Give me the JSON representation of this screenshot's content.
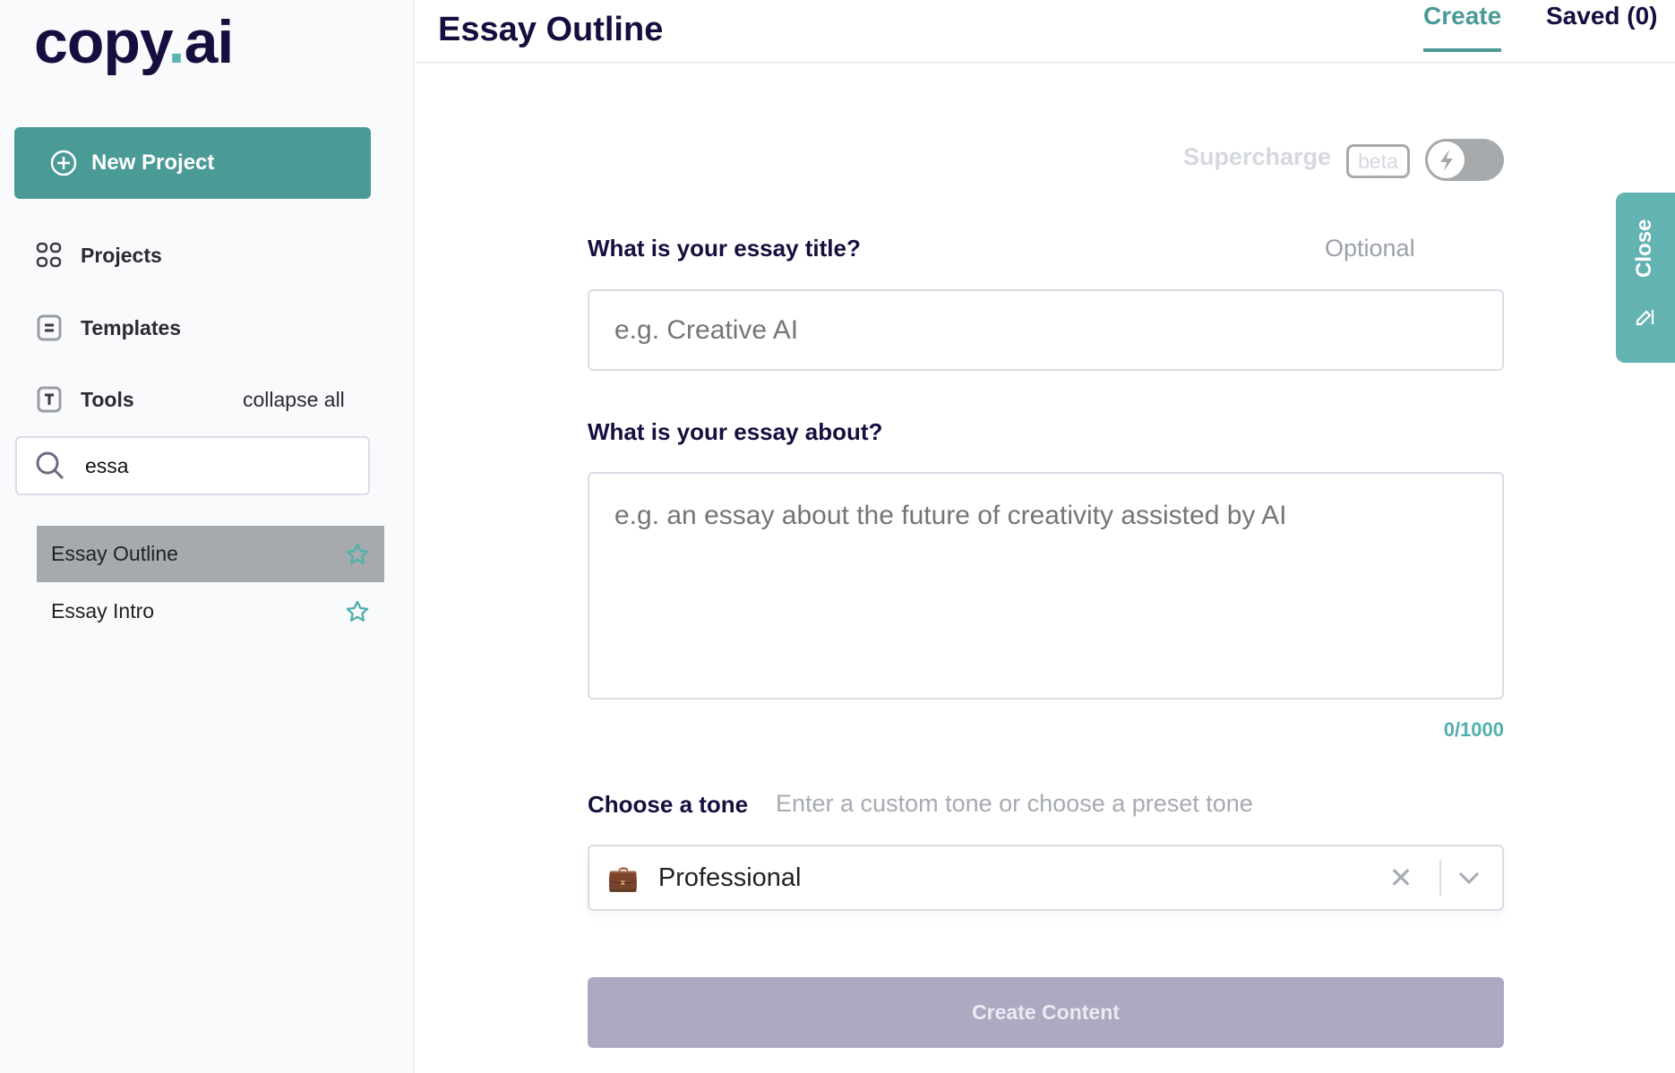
{
  "sidebar": {
    "logo": {
      "main": "copy",
      "dot": ".",
      "suffix": "ai"
    },
    "new_project": "New Project",
    "nav": [
      {
        "label": "Projects",
        "icon": "grid-icon"
      },
      {
        "label": "Templates",
        "icon": "template-icon"
      },
      {
        "label": "Tools",
        "icon": "tools-icon"
      }
    ],
    "collapse_all": "collapse all",
    "search": {
      "value": "essa"
    },
    "items": [
      {
        "label": "Essay Outline",
        "active": true,
        "icon": "star-icon"
      },
      {
        "label": "Essay Intro",
        "active": false,
        "icon": "star-icon"
      }
    ]
  },
  "header": {
    "title": "Essay Outline",
    "tabs": [
      {
        "label": "Create",
        "active": true
      },
      {
        "label": "Saved (0)",
        "active": false
      }
    ]
  },
  "supercharge": {
    "label": "Supercharge",
    "badge": "beta",
    "enabled": false
  },
  "form": {
    "title_label": "What is your essay title?",
    "title_optional": "Optional",
    "title_placeholder": "e.g. Creative AI",
    "about_label": "What is your essay about?",
    "about_placeholder": "e.g. an essay about the future of creativity assisted by AI",
    "char_count": "0/1000",
    "tone_label": "Choose a tone",
    "tone_hint": "Enter a custom tone or choose a preset tone",
    "tone_value": "Professional",
    "tone_icon": "briefcase-icon",
    "submit": "Create Content"
  },
  "close_tab": "Close",
  "colors": {
    "accent": "#4a9a96",
    "brand_dark": "#150f40",
    "disabled_button": "#aea9c2"
  }
}
